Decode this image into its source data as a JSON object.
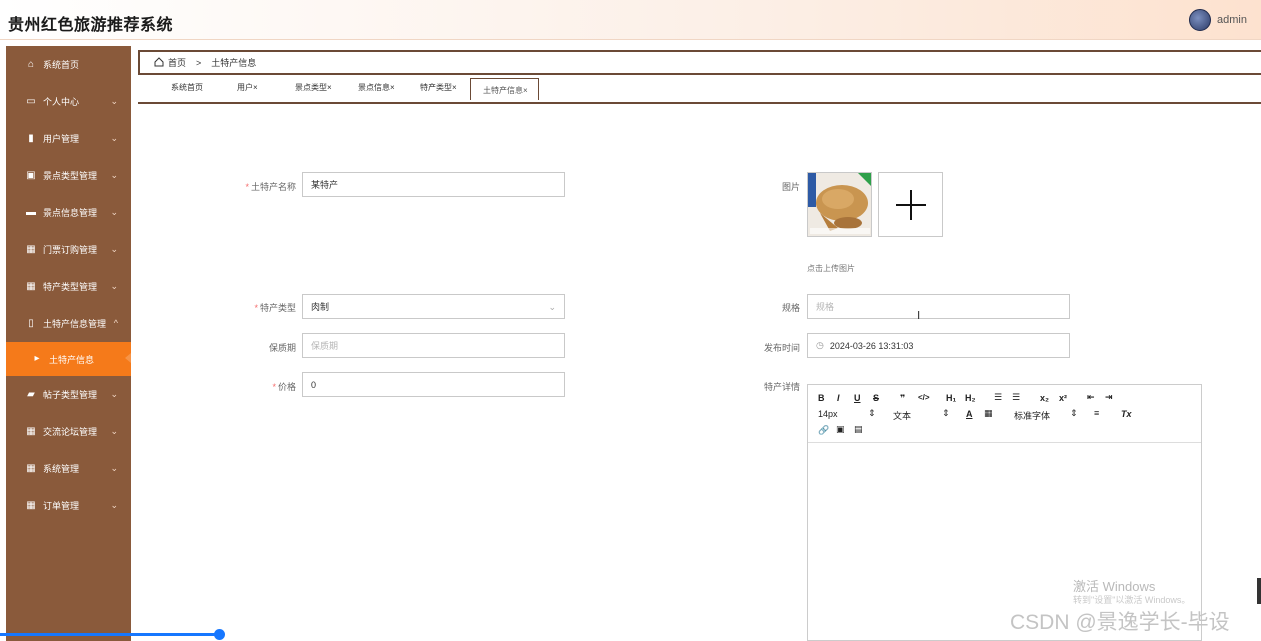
{
  "header": {
    "app_title": "贵州红色旅游推荐系统",
    "username": "admin"
  },
  "sidebar": {
    "items": [
      {
        "label": "系统首页",
        "icon": "home-icon",
        "chevron": ""
      },
      {
        "label": "个人中心",
        "icon": "id-card-icon",
        "chevron": "⌄"
      },
      {
        "label": "用户管理",
        "icon": "book-icon",
        "chevron": "⌄"
      },
      {
        "label": "景点类型管理",
        "icon": "clipboard-icon",
        "chevron": "⌄"
      },
      {
        "label": "景点信息管理",
        "icon": "monitor-icon",
        "chevron": "⌄"
      },
      {
        "label": "门票订购管理",
        "icon": "grid-icon",
        "chevron": "⌄"
      },
      {
        "label": "特产类型管理",
        "icon": "grid-icon",
        "chevron": "⌄"
      },
      {
        "label": "土特产信息管理",
        "icon": "tablet-icon",
        "chevron": "^"
      },
      {
        "label": "土特产信息",
        "icon": "caret-right-icon",
        "chevron": ""
      },
      {
        "label": "帖子类型管理",
        "icon": "comment-icon",
        "chevron": "⌄"
      },
      {
        "label": "交流论坛管理",
        "icon": "grid-icon",
        "chevron": "⌄"
      },
      {
        "label": "系统管理",
        "icon": "grid-icon",
        "chevron": "⌄"
      },
      {
        "label": "订单管理",
        "icon": "grid-icon",
        "chevron": "⌄"
      }
    ],
    "active_index": 8
  },
  "breadcrumb": {
    "home": "首页",
    "separator": ">",
    "current": "土特产信息"
  },
  "tabs": [
    {
      "label": "系统首页"
    },
    {
      "label": "用户×"
    },
    {
      "label": "景点类型×"
    },
    {
      "label": "景点信息×"
    },
    {
      "label": "特产类型×"
    },
    {
      "label": "土特产信息×"
    }
  ],
  "form": {
    "name_label": "土特产名称",
    "name_value": "某特产",
    "image_label": "图片",
    "upload_tip": "点击上传图片",
    "type_label": "特产类型",
    "type_value": "肉制",
    "spec_label": "规格",
    "spec_placeholder": "规格",
    "shelf_label": "保质期",
    "shelf_placeholder": "保质期",
    "time_label": "发布时间",
    "time_value": "2024-03-26 13:31:03",
    "price_label": "价格",
    "price_value": "0",
    "detail_label": "特产详情",
    "required_mark": "*"
  },
  "editor": {
    "font_size": "14px",
    "text_type": "文本",
    "font_family": "标准字体"
  },
  "overlay": {
    "activate_title": "激活 Windows",
    "activate_sub": "转到\"设置\"以激活 Windows。",
    "csdn_text": "CSDN @景逸学长-毕设"
  },
  "colors": {
    "sidebar_bg": "#8a5a3b",
    "active_item": "#f57a1a",
    "border_brown": "#6b4a36"
  }
}
